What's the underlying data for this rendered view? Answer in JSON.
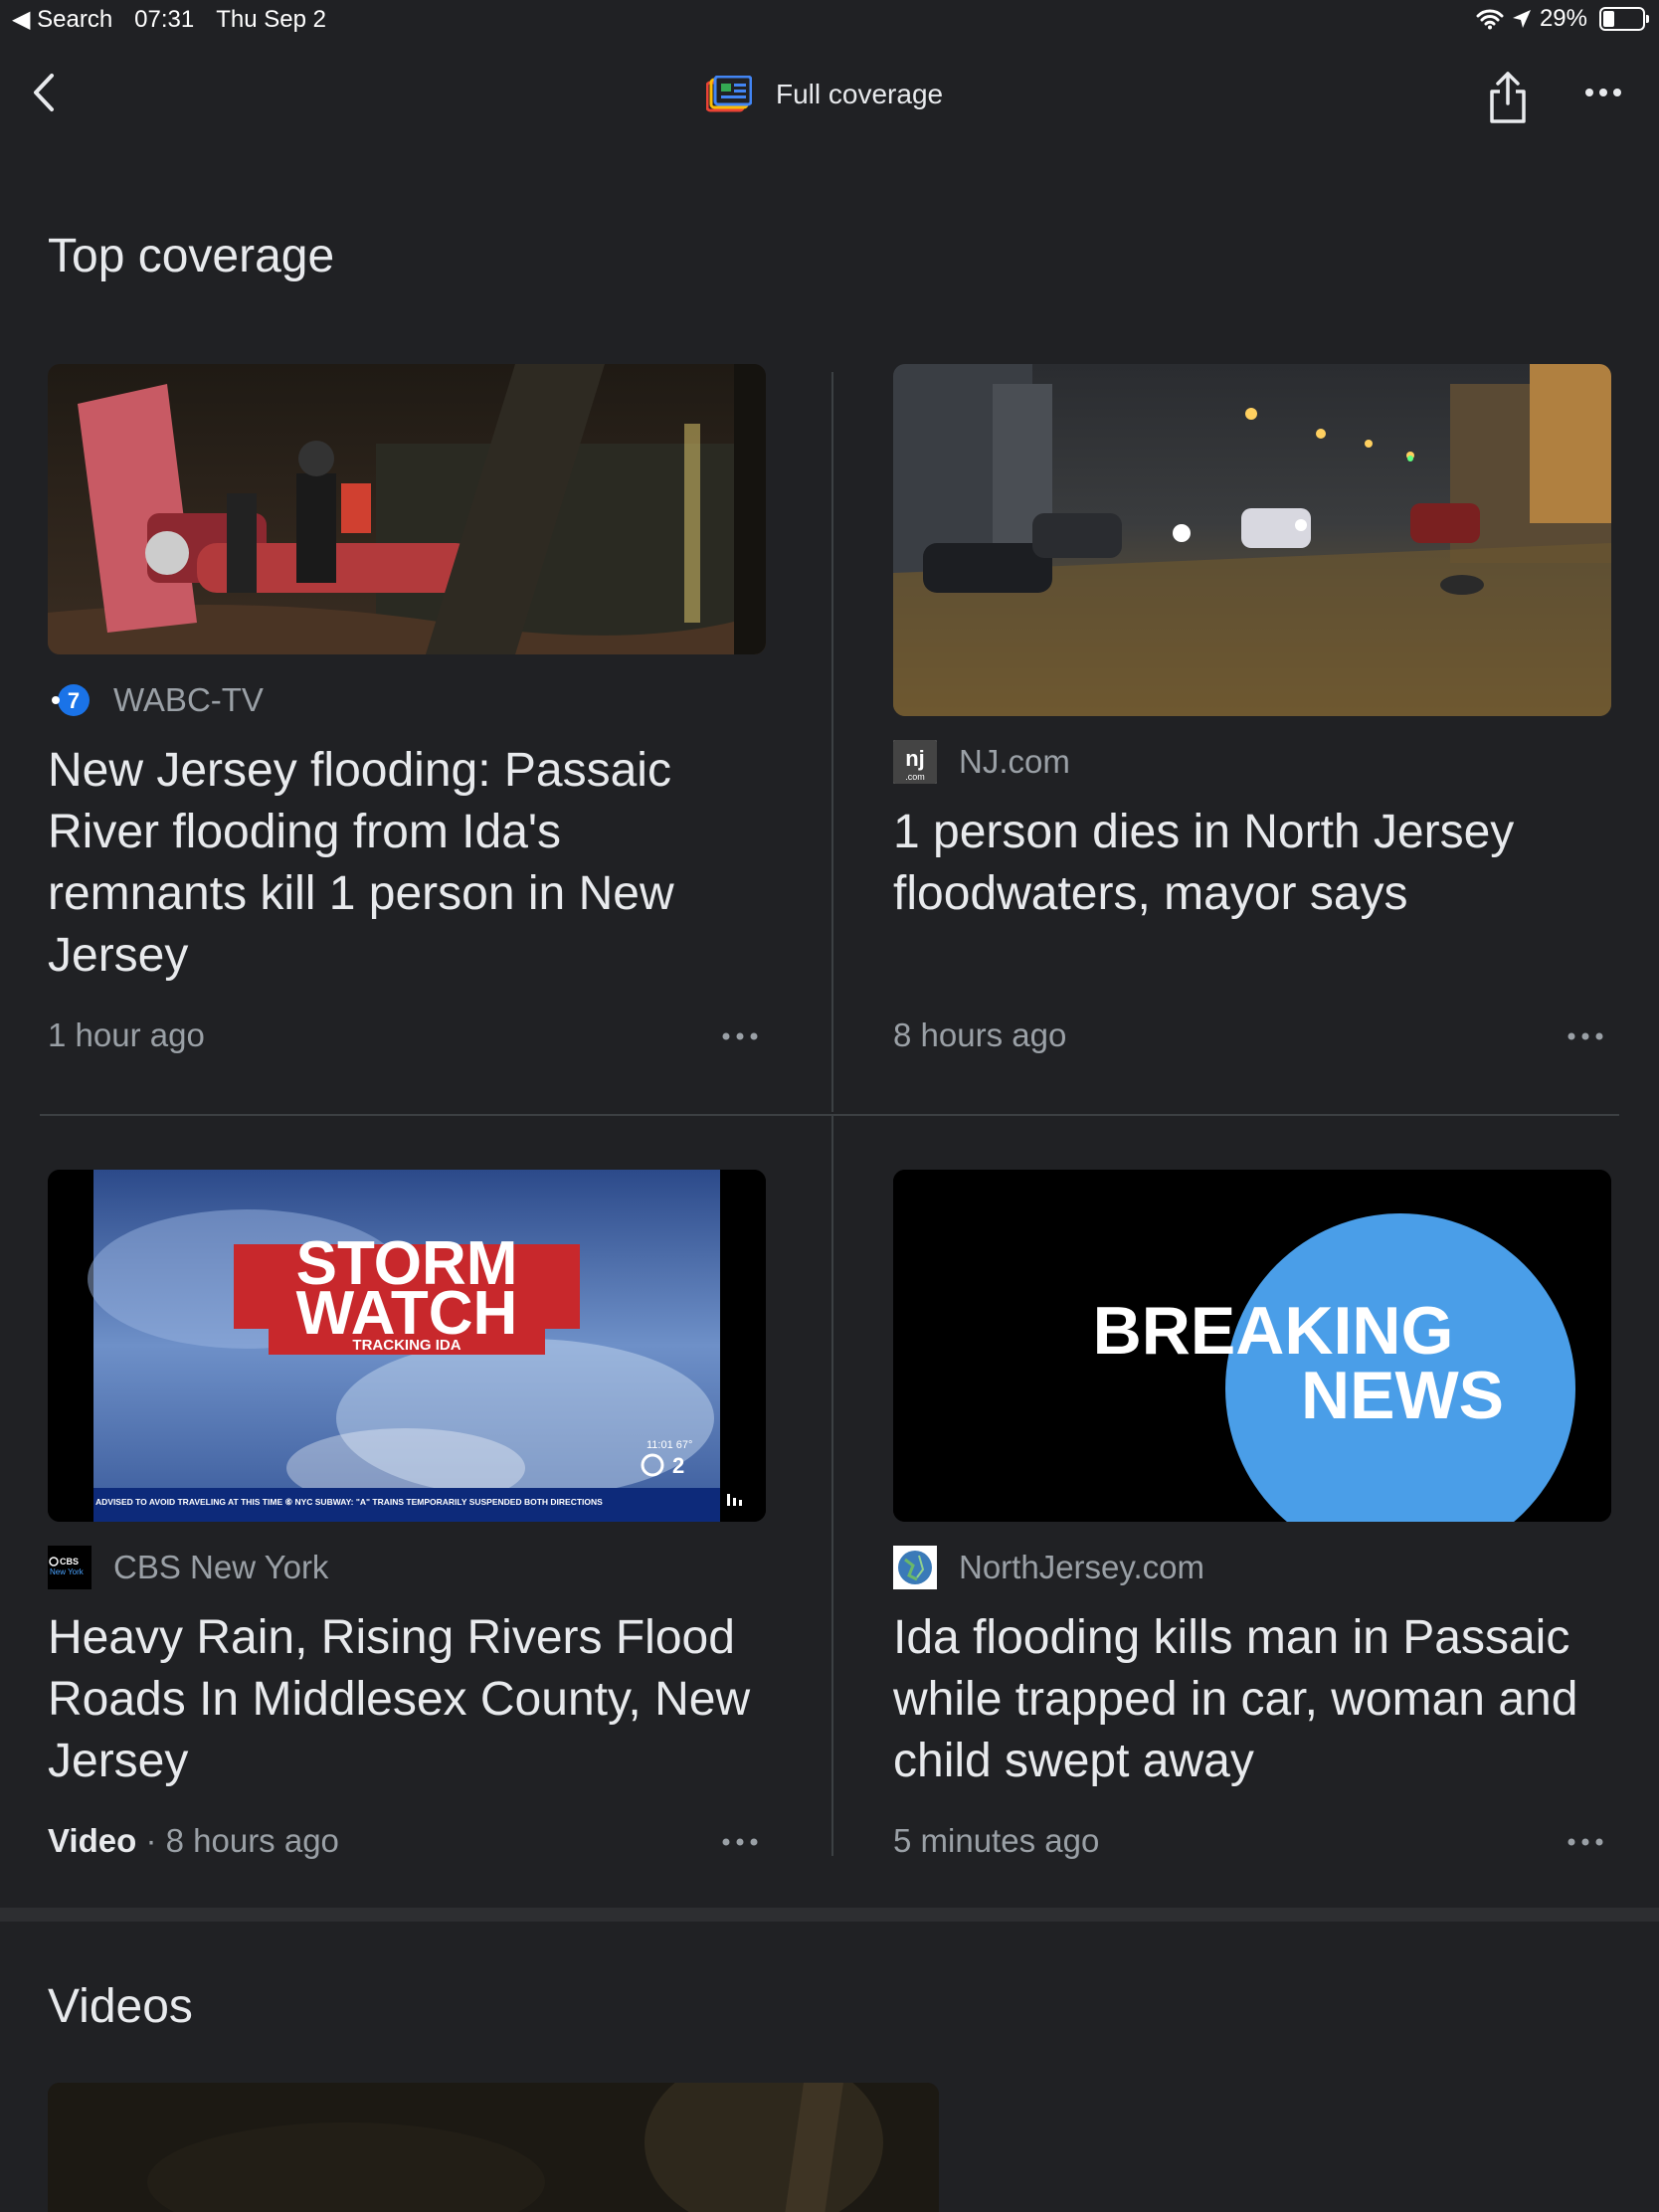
{
  "status_bar": {
    "back_app": "◀ Search",
    "time": "07:31",
    "date": "Thu Sep 2",
    "battery": "29%"
  },
  "nav": {
    "title": "Full coverage"
  },
  "sections": {
    "top_coverage": "Top coverage",
    "videos": "Videos"
  },
  "cards": [
    {
      "source": "WABC-TV",
      "headline": "New Jersey flooding: Passaic River flooding from Ida's remnants kill 1 person in New Jersey",
      "time": "1 hour ago"
    },
    {
      "source": "NJ.com",
      "headline": "1 person dies in North Jersey floodwaters, mayor says",
      "time": "8 hours ago"
    },
    {
      "source": "CBS New York",
      "headline": "Heavy Rain, Rising Rivers Flood Roads In Middlesex County, New Jersey",
      "label": "Video",
      "separator": "·",
      "time": "8 hours ago",
      "thumb": {
        "title_1": "STORM",
        "title_2": "WATCH",
        "subtitle": "TRACKING IDA",
        "temp": "11:01  67°",
        "ticker": "ADVISED TO AVOID TRAVELING AT THIS TIME  ⑥ NYC SUBWAY: \"A\" TRAINS TEMPORARILY SUSPENDED BOTH DIRECTIONS"
      }
    },
    {
      "source": "NorthJersey.com",
      "headline": "Ida flooding kills man in Passaic while trapped in car, woman and child swept away",
      "time": "5 minutes ago",
      "thumb": {
        "line_1": "BREAKING",
        "line_2": "NEWS"
      }
    }
  ],
  "colors": {
    "background": "#202124",
    "text": "#e8eaed",
    "muted": "#9aa0a6",
    "breaking_blue": "#4a9ee8",
    "storm_red": "#c8282c"
  }
}
